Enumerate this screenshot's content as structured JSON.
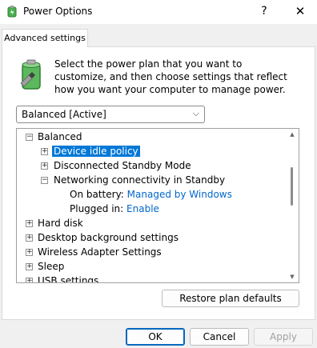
{
  "window": {
    "title": "Power Options",
    "help": "?",
    "close": "✕"
  },
  "tab": {
    "label": "Advanced settings"
  },
  "description": "Select the power plan that you want to customize, and then choose settings that reflect how you want your computer to manage power.",
  "plan_select": {
    "value": "Balanced [Active]"
  },
  "tree": {
    "balanced": "Balanced",
    "device_idle": "Device idle policy",
    "disconnected_standby": "Disconnected Standby Mode",
    "networking": "Networking connectivity in Standby",
    "on_battery_label": "On battery:",
    "on_battery_value": "Managed by Windows",
    "plugged_in_label": "Plugged in:",
    "plugged_in_value": "Enable",
    "hard_disk": "Hard disk",
    "desktop_bg": "Desktop background settings",
    "wireless": "Wireless Adapter Settings",
    "sleep": "Sleep",
    "usb": "USB settings"
  },
  "buttons": {
    "restore": "Restore plan defaults",
    "ok": "OK",
    "cancel": "Cancel",
    "apply": "Apply"
  },
  "colors": {
    "selection": "#0078d7",
    "link": "#0066cc",
    "accent": "#0067c0"
  }
}
